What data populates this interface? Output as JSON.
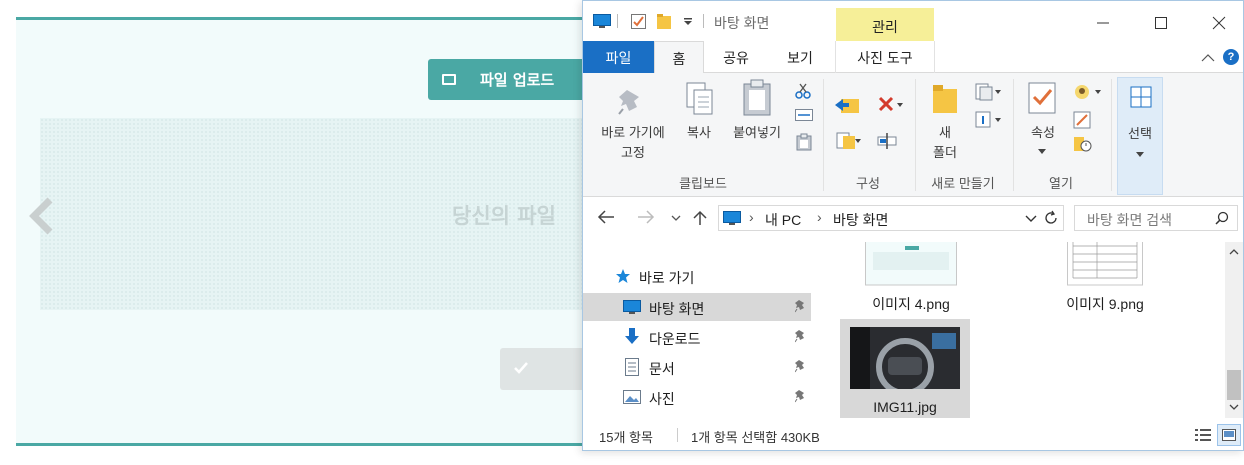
{
  "webpage": {
    "upload_button_label": "파일 업로드",
    "drop_text": "당신의 파일"
  },
  "explorer": {
    "title": "바탕 화면",
    "manage_tab": "관리",
    "tabs": [
      {
        "label": "파일"
      },
      {
        "label": "홈"
      },
      {
        "label": "공유"
      },
      {
        "label": "보기"
      },
      {
        "label": "사진 도구"
      }
    ],
    "help_label": "?",
    "ribbon": {
      "pin_label_line1": "바로 가기에",
      "pin_label_line2": "고정",
      "copy_label": "복사",
      "paste_label": "붙여넣기",
      "clipboard_group": "클립보드",
      "organize_group": "구성",
      "new_folder_line1": "새",
      "new_folder_line2": "폴더",
      "new_group": "새로 만들기",
      "properties_label": "속성",
      "open_group": "열기",
      "select_label": "선택"
    },
    "address": {
      "crumbs": [
        "내 PC",
        "바탕 화면"
      ],
      "search_placeholder": "바탕 화면 검색"
    },
    "nav": {
      "quick_access": "바로 가기",
      "items": [
        {
          "label": "바탕 화면",
          "icon": "desktop-icon",
          "selected": true
        },
        {
          "label": "다운로드",
          "icon": "download-icon",
          "selected": false
        },
        {
          "label": "문서",
          "icon": "document-icon",
          "selected": false
        },
        {
          "label": "사진",
          "icon": "pictures-icon",
          "selected": false
        }
      ]
    },
    "files": [
      {
        "name": "이미지 4.png",
        "selected": false
      },
      {
        "name": "이미지 9.png",
        "selected": false
      },
      {
        "name": "IMG11.jpg",
        "selected": true
      }
    ],
    "status": {
      "item_count": "15개 항목",
      "selection": "1개 항목 선택함 430KB"
    }
  },
  "colors": {
    "accent_teal": "#4aa8a4",
    "file_tab_blue": "#1a6fc5",
    "manage_yellow": "#f6ef98",
    "selection_grey": "#d8d8d8"
  }
}
